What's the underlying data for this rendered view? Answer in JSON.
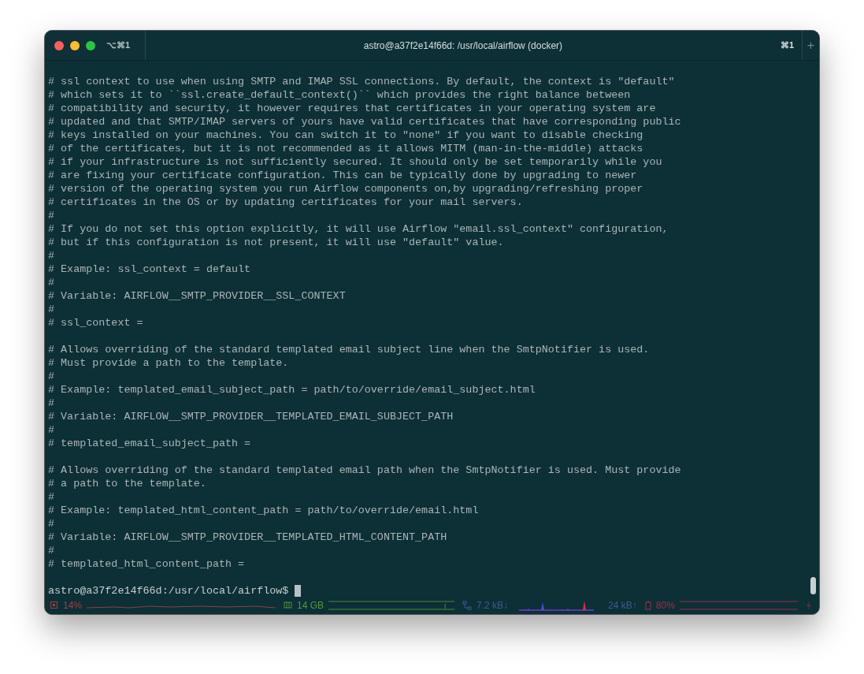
{
  "window": {
    "title": "astro@a37f2e14f66d: /usr/local/airflow (docker)",
    "tab_label": "⌥⌘1",
    "shortcut": "⌘1",
    "new_tab": "+"
  },
  "terminal": {
    "blocks": [
      [
        "# ssl context to use when using SMTP and IMAP SSL connections. By default, the context is \"default\"",
        "# which sets it to ``ssl.create_default_context()`` which provides the right balance between",
        "# compatibility and security, it however requires that certificates in your operating system are",
        "# updated and that SMTP/IMAP servers of yours have valid certificates that have corresponding public",
        "# keys installed on your machines. You can switch it to \"none\" if you want to disable checking",
        "# of the certificates, but it is not recommended as it allows MITM (man-in-the-middle) attacks",
        "# if your infrastructure is not sufficiently secured. It should only be set temporarily while you",
        "# are fixing your certificate configuration. This can be typically done by upgrading to newer",
        "# version of the operating system you run Airflow components on,by upgrading/refreshing proper",
        "# certificates in the OS or by updating certificates for your mail servers.",
        "#",
        "# If you do not set this option explicitly, it will use Airflow \"email.ssl_context\" configuration,",
        "# but if this configuration is not present, it will use \"default\" value.",
        "#",
        "# Example: ssl_context = default",
        "#",
        "# Variable: AIRFLOW__SMTP_PROVIDER__SSL_CONTEXT",
        "#",
        "# ssl_context ="
      ],
      [
        "# Allows overriding of the standard templated email subject line when the SmtpNotifier is used.",
        "# Must provide a path to the template.",
        "#",
        "# Example: templated_email_subject_path = path/to/override/email_subject.html",
        "#",
        "# Variable: AIRFLOW__SMTP_PROVIDER__TEMPLATED_EMAIL_SUBJECT_PATH",
        "#",
        "# templated_email_subject_path ="
      ],
      [
        "# Allows overriding of the standard templated email path when the SmtpNotifier is used. Must provide",
        "# a path to the template.",
        "#",
        "# Example: templated_html_content_path = path/to/override/email.html",
        "#",
        "# Variable: AIRFLOW__SMTP_PROVIDER__TEMPLATED_HTML_CONTENT_PATH",
        "#",
        "# templated_html_content_path ="
      ]
    ],
    "prompt": "astro@a37f2e14f66d:/usr/local/airflow$"
  },
  "status_bar": {
    "cpu": "14%",
    "memory": "14 GB",
    "download": "7.2 kB↓",
    "upload": "24 kB↑",
    "battery": "80%"
  }
}
